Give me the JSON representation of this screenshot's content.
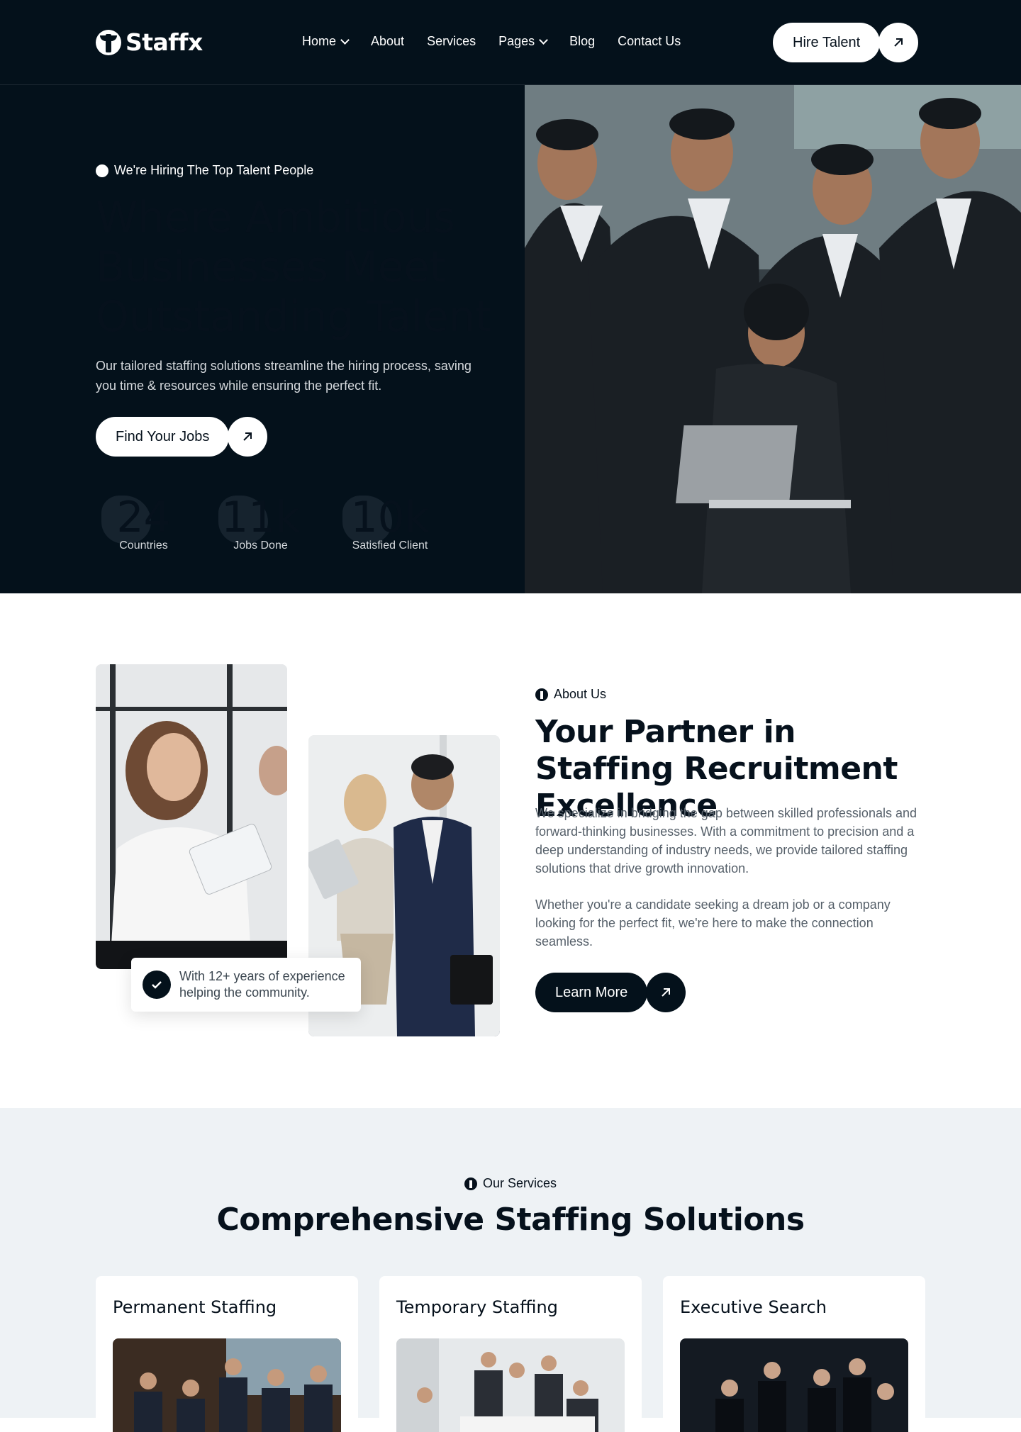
{
  "header": {
    "brand": "Staffx",
    "nav": [
      {
        "label": "Home",
        "dropdown": true
      },
      {
        "label": "About",
        "dropdown": false
      },
      {
        "label": "Services",
        "dropdown": false
      },
      {
        "label": "Pages",
        "dropdown": true
      },
      {
        "label": "Blog",
        "dropdown": false
      },
      {
        "label": "Contact Us",
        "dropdown": false
      }
    ],
    "cta": "Hire Talent"
  },
  "hero": {
    "eyebrow": "We're Hiring The Top Talent People",
    "title": "Where Ambitious Businesses Meet Outstanding Talent",
    "description": "Our tailored staffing solutions streamline the hiring process, saving you time & resources while ensuring the perfect fit.",
    "cta": "Find Your Jobs",
    "stats": [
      {
        "value": "24",
        "label": "Countries"
      },
      {
        "value": "11k",
        "label": "Jobs Done"
      },
      {
        "value": "10k",
        "label": "Satisfied Client"
      }
    ]
  },
  "about": {
    "eyebrow": "About Us",
    "title": "Your Partner in Staffing Recruitment Excellence",
    "paragraph1": "We specialize in bridging the gap between skilled professionals and forward-thinking businesses. With a commitment to precision and a deep understanding of industry needs, we provide tailored staffing solutions that drive growth  innovation.",
    "paragraph2": "Whether you're a candidate seeking a dream job or a company looking for the perfect fit, we're here to make the connection seamless.",
    "badge": "With 12+ years of experience helping the community.",
    "cta": "Learn More"
  },
  "services": {
    "eyebrow": "Our Services",
    "title": "Comprehensive Staffing Solutions",
    "cards": [
      {
        "title": "Permanent Staffing"
      },
      {
        "title": "Temporary Staffing"
      },
      {
        "title": "Executive Search"
      }
    ]
  },
  "colors": {
    "dark": "#04111b",
    "light_bg": "#eef2f5",
    "white": "#ffffff"
  }
}
